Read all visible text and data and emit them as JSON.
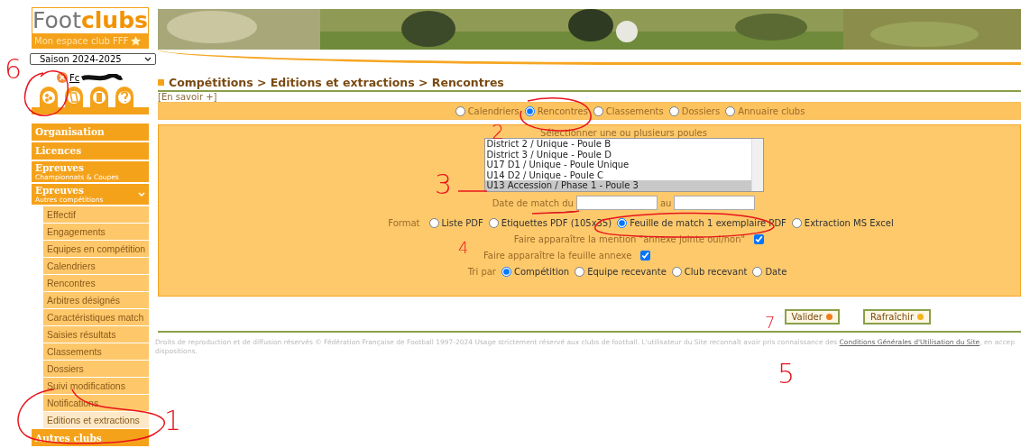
{
  "logo": {
    "brand_a": "Foot",
    "brand_b": "clubs",
    "tagline": "Mon espace club FFF"
  },
  "season_select": {
    "value": "Saison 2024-2025"
  },
  "user": {
    "name": "Fc"
  },
  "menu": [
    {
      "label": "Organisation",
      "expanded": false
    },
    {
      "label": "Licences",
      "expanded": false
    },
    {
      "label": "Epreuves",
      "sublabel": "Championnats & Coupes",
      "expanded": false
    },
    {
      "label": "Epreuves",
      "sublabel": "Autres compétitions",
      "expanded": true,
      "children": [
        {
          "label": "Effectif",
          "selected": false
        },
        {
          "label": "Engagements",
          "selected": false
        },
        {
          "label": "Equipes en compétition",
          "selected": false
        },
        {
          "label": "Calendriers",
          "selected": false
        },
        {
          "label": "Rencontres",
          "selected": false
        },
        {
          "label": "Arbitres désignés",
          "selected": false
        },
        {
          "label": "Caractéristiques match",
          "selected": false
        },
        {
          "label": "Saisies résultats",
          "selected": false
        },
        {
          "label": "Classements",
          "selected": false
        },
        {
          "label": "Dossiers",
          "selected": false
        },
        {
          "label": "Suivi modifications",
          "selected": false
        },
        {
          "label": "Notifications",
          "selected": false
        },
        {
          "label": "Editions et extractions",
          "selected": true
        }
      ]
    },
    {
      "label": "Autres clubs",
      "expanded": false
    }
  ],
  "breadcrumb": "Compétitions > Editions et extractions > Rencontres",
  "info_link": "[En savoir +]",
  "modes": [
    {
      "label": "Calendriers",
      "selected": false
    },
    {
      "label": "Rencontres",
      "selected": true
    },
    {
      "label": "Classements",
      "selected": false
    },
    {
      "label": "Dossiers",
      "selected": false
    },
    {
      "label": "Annuaire clubs",
      "selected": false
    }
  ],
  "poules": {
    "label": "Sélectionner une ou plusieurs poules",
    "items": [
      {
        "label": "District 2 / Unique - Poule B",
        "selected": false
      },
      {
        "label": "District 3 / Unique - Poule D",
        "selected": false
      },
      {
        "label": "U17 D1 / Unique - Poule Unique",
        "selected": false
      },
      {
        "label": "U14 D2 / Unique - Poule C",
        "selected": false
      },
      {
        "label": "U13 Accession / Phase 1 - Poule 3",
        "selected": true
      }
    ]
  },
  "dates": {
    "label_from": "Date de match du",
    "label_to": "au"
  },
  "format": {
    "label": "Format",
    "options": [
      {
        "label": "Liste PDF",
        "selected": false
      },
      {
        "label": "Etiquettes PDF (105x35)",
        "selected": false
      },
      {
        "label": "Feuille de match 1 exemplaire PDF",
        "selected": true
      },
      {
        "label": "Extraction MS Excel",
        "selected": false
      }
    ]
  },
  "options": [
    {
      "label": "Faire apparaître la mention \"annexe jointe oui/non\"",
      "checked": true
    },
    {
      "label": "Faire apparaître la feuille annexe",
      "checked": true
    }
  ],
  "sort": {
    "label": "Tri par",
    "options": [
      {
        "label": "Compétition",
        "selected": true
      },
      {
        "label": "Equipe recevante",
        "selected": false
      },
      {
        "label": "Club recevant",
        "selected": false
      },
      {
        "label": "Date",
        "selected": false
      }
    ]
  },
  "buttons": [
    {
      "label": "Valider",
      "color": "#f07c1e"
    },
    {
      "label": "Rafraîchir",
      "color": "#f5b21e"
    }
  ],
  "footer": {
    "text": "Droits de reproduction et de diffusion réservés © Fédération Française de Football 1997-2024 Usage strictement réservé aux clubs de football. L'utilisateur du Site reconnaît avoir pris connaissance des ",
    "link": "Conditions Générales d'Utilisation du Site",
    "after": ", en accep",
    "line2": "dispositions."
  },
  "annotations": [
    {
      "label": "6"
    },
    {
      "label": "2"
    },
    {
      "label": "3"
    },
    {
      "label": "4"
    },
    {
      "label": "7"
    },
    {
      "label": "5"
    },
    {
      "label": "1"
    }
  ]
}
